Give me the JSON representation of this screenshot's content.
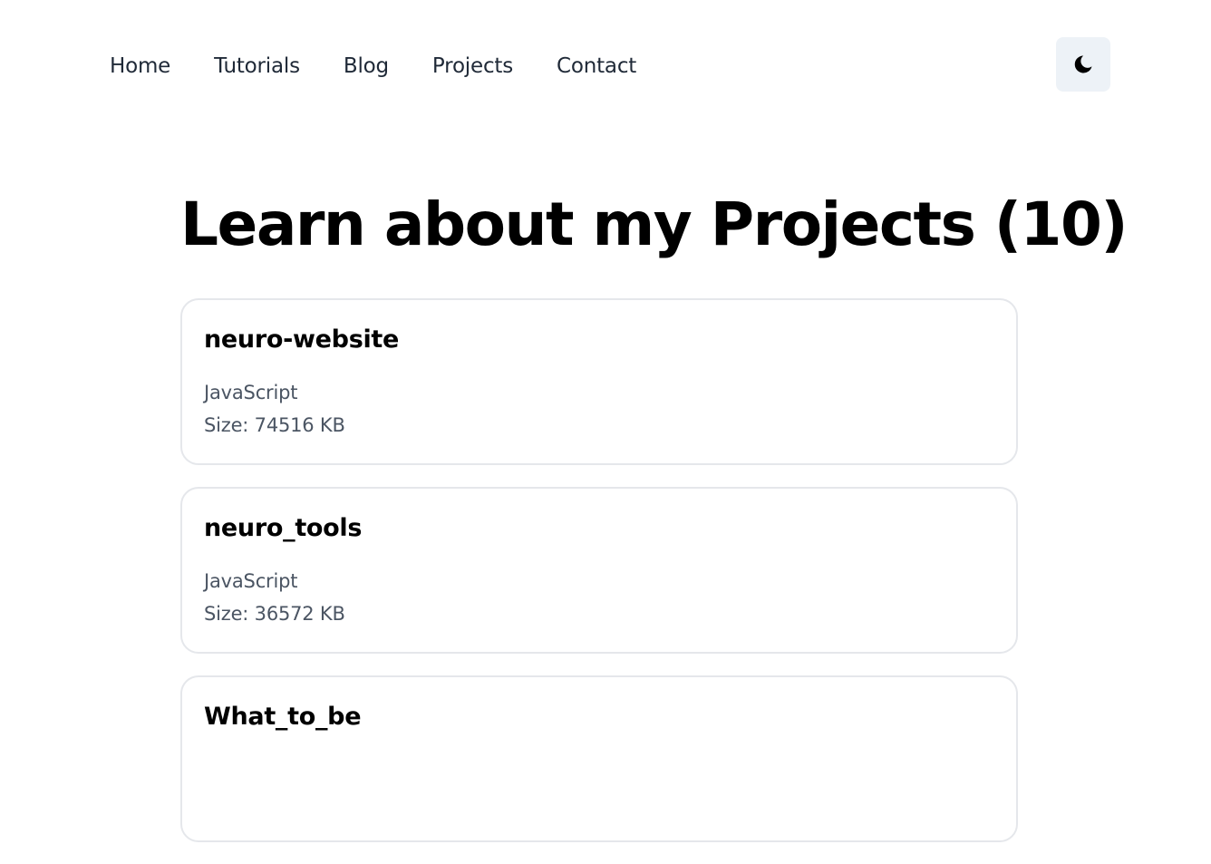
{
  "nav": {
    "links": [
      "Home",
      "Tutorials",
      "Blog",
      "Projects",
      "Contact"
    ],
    "theme_toggle_icon": "moon-icon"
  },
  "main": {
    "title": "Learn about my Projects (10)",
    "projects": [
      {
        "name": "neuro-website",
        "language": "JavaScript",
        "size": "Size: 74516 KB"
      },
      {
        "name": "neuro_tools",
        "language": "JavaScript",
        "size": "Size: 36572 KB"
      },
      {
        "name": "What_to_be",
        "language": "",
        "size": ""
      }
    ]
  },
  "colors": {
    "toggle_bg": "#edf2f7",
    "card_border": "#e5e7eb",
    "meta_text": "#4b5563"
  }
}
